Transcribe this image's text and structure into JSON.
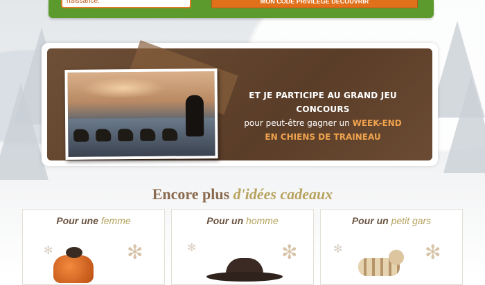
{
  "top_form": {
    "birth_field_text": "naissance.",
    "submit_label": "MON CODE PRIVILÈGE DÉCOUVRIR"
  },
  "contest": {
    "line1": "ET JE PARTICIPE AU GRAND JEU CONCOURS",
    "line2_prefix": "pour peut-être gagner un",
    "line2_highlight": "WEEK-END",
    "line3": "EN CHIENS DE TRAINEAU"
  },
  "ideas_heading": {
    "prefix": "Encore plus",
    "italic": "d'idées cadeaux"
  },
  "cards": [
    {
      "prefix": "Pour une",
      "highlight": "femme"
    },
    {
      "prefix": "Pour un",
      "highlight": "homme"
    },
    {
      "prefix": "Pour un",
      "highlight": "petit gars"
    }
  ],
  "colors": {
    "green_band": "#5c9a2d",
    "orange_accent": "#e0701a",
    "brown_panel": "#5a3d28",
    "gold_text": "#f0a34d"
  }
}
